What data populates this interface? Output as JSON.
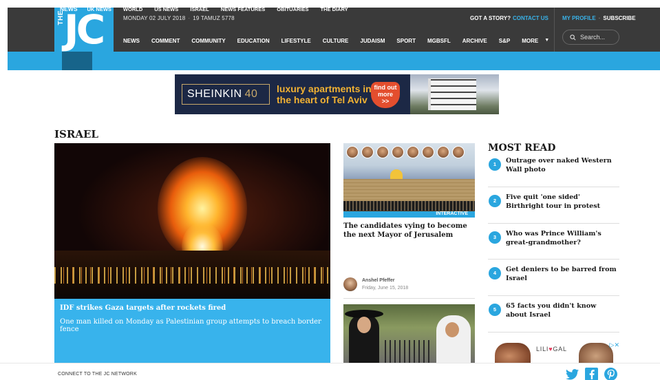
{
  "header": {
    "logo_the": "THE",
    "logo_jc": "JC",
    "date": "MONDAY 02 JULY 2018",
    "hebrew_date": "19 TAMUZ 5778",
    "got_a_story": "GOT A STORY?",
    "contact_us": "CONTACT US",
    "my_profile": "MY PROFILE",
    "subscribe": "SUBSCRIBE",
    "search_placeholder": "Search...",
    "nav": [
      "NEWS",
      "COMMENT",
      "COMMUNITY",
      "EDUCATION",
      "LIFESTYLE",
      "CULTURE",
      "JUDAISM",
      "SPORT",
      "MGBSFL",
      "ARCHIVE",
      "S&P",
      "MORE"
    ]
  },
  "subnav": [
    "NEWS",
    "UK NEWS",
    "WORLD",
    "US NEWS",
    "ISRAEL",
    "NEWS FEATURES",
    "OBITUARIES",
    "THE DIARY"
  ],
  "ad_banner": {
    "brand": "SHEINKIN",
    "brand_number": "40",
    "tagline_1": "luxury apartments in",
    "tagline_2": "the heart of Tel Aviv",
    "cta_1": "find out",
    "cta_2": "more",
    "cta_3": ">>"
  },
  "section_title": "ISRAEL",
  "lead_story": {
    "headline": "IDF strikes Gaza targets after rockets fired",
    "standfirst": "One man killed on Monday as Palestinian group attempts to breach border fence"
  },
  "middle_story": {
    "label": "INTERACTIVE",
    "headline": "The candidates vying to become the next Mayor of Jerusalem",
    "author": "Anshel Pfeffer",
    "date": "Friday, June 15, 2018"
  },
  "most_read": {
    "title": "MOST READ",
    "items": [
      {
        "num": "1",
        "text": "Outrage over naked Western Wall photo"
      },
      {
        "num": "2",
        "text": "Five quit 'one sided' Birthright tour in protest"
      },
      {
        "num": "3",
        "text": "Who was Prince William's great-grandmother?"
      },
      {
        "num": "4",
        "text": "Get deniers to be barred from Israel"
      },
      {
        "num": "5",
        "text": "65 facts you didn't know about Israel"
      }
    ]
  },
  "side_ad": {
    "logo_pre": "LILI",
    "logo_post": "GAL",
    "ad_marker": "▷✕"
  },
  "footer": {
    "connect": "CONNECT TO THE JC NETWORK"
  },
  "colors": {
    "brand_blue": "#2aa6df",
    "dark_bar": "#3a3a3a",
    "active_tab": "#17648a"
  },
  "icons": [
    "search-icon",
    "caret-down-icon",
    "twitter-icon",
    "facebook-icon",
    "pinterest-icon"
  ]
}
